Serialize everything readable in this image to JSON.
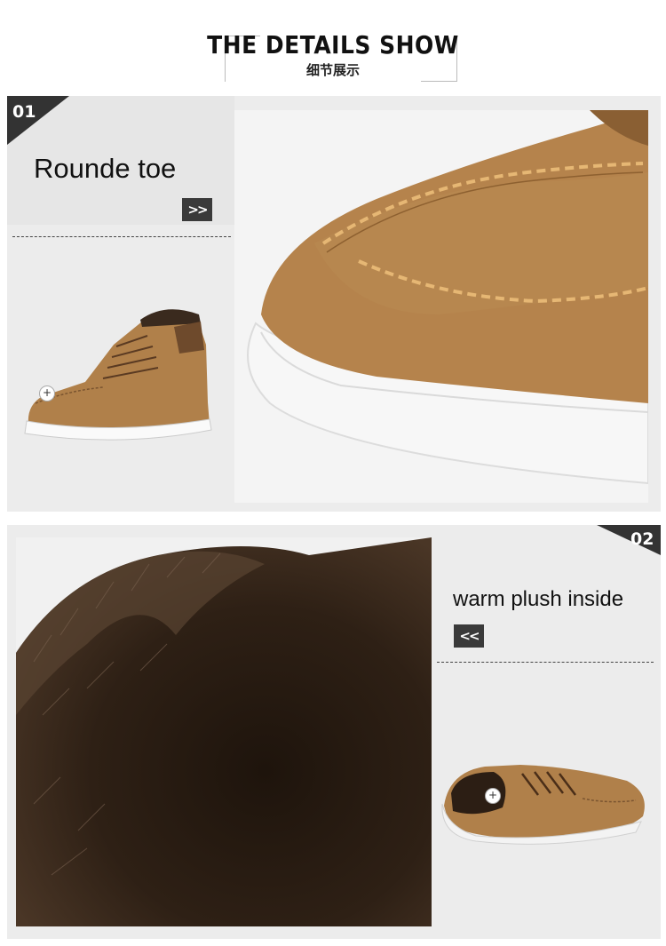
{
  "header": {
    "title": "THE DETAILS SHOW",
    "subtitle": "细节展示"
  },
  "detail1": {
    "number": "01",
    "feature": "Rounde toe",
    "arrow": ">>"
  },
  "detail2": {
    "number": "02",
    "feature": "warm plush inside",
    "arrow": "<<"
  },
  "hotspot": "+",
  "colors": {
    "panel": "#ececec",
    "badge": "#333333",
    "suede": "#b0804a",
    "fur": "#3b2a1c"
  },
  "icons": [
    "fast-forward-arrow-icon",
    "rewind-arrow-icon",
    "plus-hotspot-icon"
  ]
}
